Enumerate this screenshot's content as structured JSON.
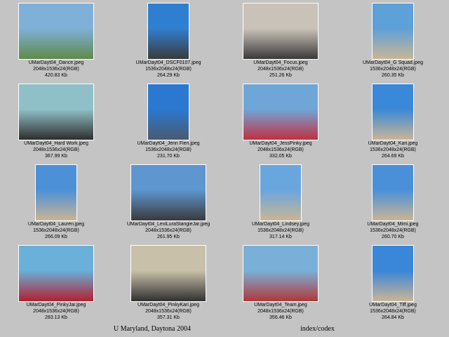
{
  "thumbnails": [
    {
      "filename": "UMarDayt04_Dance.jpeg",
      "dims": "2048x1536x24(RGB)",
      "size": "420.83 Kb",
      "orient": "land",
      "sky": "#7fb0d8",
      "ground": "#5f8a4a"
    },
    {
      "filename": "UMarDayt04_DSCF0107.jpeg",
      "dims": "1536x2048x24(RGB)",
      "size": "264.29 Kb",
      "orient": "port",
      "sky": "#2f7fd0",
      "ground": "#3b3b3b"
    },
    {
      "filename": "UMarDayt04_Focus.jpeg",
      "dims": "2048x1536x24(RGB)",
      "size": "251.26 Kb",
      "orient": "land",
      "sky": "#c9c2b8",
      "ground": "#3a3a3a"
    },
    {
      "filename": "UMarDayt04_G Squad.jpeg",
      "dims": "1536x2048x24(RGB)",
      "size": "260.35 Kb",
      "orient": "port",
      "sky": "#5ea0d8",
      "ground": "#c9b596"
    },
    {
      "filename": "UMarDayt04_Hard Work.jpeg",
      "dims": "2048x1536x24(RGB)",
      "size": "367.99 Kb",
      "orient": "land",
      "sky": "#8fc0c8",
      "ground": "#2e2e2e"
    },
    {
      "filename": "UMarDayt04_Jenn Fien.jpeg",
      "dims": "1536x2048x24(RGB)",
      "size": "231.70 Kb",
      "orient": "port",
      "sky": "#2a78d0",
      "ground": "#4a5a70"
    },
    {
      "filename": "UMarDayt04_JessPinky.jpeg",
      "dims": "2048x1536x24(RGB)",
      "size": "332.05 Kb",
      "orient": "land",
      "sky": "#6fa6d8",
      "ground": "#c03040"
    },
    {
      "filename": "UMarDayt04_Kari.jpeg",
      "dims": "1536x2048x24(RGB)",
      "size": "264.69 Kb",
      "orient": "port",
      "sky": "#3a88d8",
      "ground": "#c9b596"
    },
    {
      "filename": "UMarDayt04_Lauren.jpeg",
      "dims": "1536x2048x24(RGB)",
      "size": "266.09 Kb",
      "orient": "port",
      "sky": "#4c90d8",
      "ground": "#c9b596"
    },
    {
      "filename": "UMarDayt04_LexiLuraStangieJar.jpeg",
      "dims": "2048x1536x24(RGB)",
      "size": "261.95 Kb",
      "orient": "land",
      "sky": "#5e96d0",
      "ground": "#3a3a3a"
    },
    {
      "filename": "UMarDayt04_Lindsey.jpeg",
      "dims": "1536x2048x24(RGB)",
      "size": "317.14 Kb",
      "orient": "port",
      "sky": "#6aa6de",
      "ground": "#c9b596"
    },
    {
      "filename": "UMarDayt04_Mimi.jpeg",
      "dims": "1536x2048x24(RGB)",
      "size": "260.70 Kb",
      "orient": "port",
      "sky": "#4a90d8",
      "ground": "#c9b596"
    },
    {
      "filename": "UMarDayt04_PinkyJar.jpeg",
      "dims": "2048x1536x24(RGB)",
      "size": "283.13 Kb",
      "orient": "land",
      "sky": "#6ab0d8",
      "ground": "#b02030"
    },
    {
      "filename": "UMarDayt04_PinkyKari.jpeg",
      "dims": "2048x1536x24(RGB)",
      "size": "357.31 Kb",
      "orient": "land",
      "sky": "#c8c0a8",
      "ground": "#303030"
    },
    {
      "filename": "UMarDayt04_Team.jpeg",
      "dims": "2048x1536x24(RGB)",
      "size": "356.46 Kb",
      "orient": "land",
      "sky": "#7ab0d8",
      "ground": "#b03838"
    },
    {
      "filename": "UMarDayt04_Tiff.jpeg",
      "dims": "1536x2048x24(RGB)",
      "size": "264.84 Kb",
      "orient": "port",
      "sky": "#3a86d8",
      "ground": "#c9b596"
    }
  ],
  "footer": {
    "title": "U Maryland, Daytona 2004",
    "index_link": "index/codex"
  }
}
